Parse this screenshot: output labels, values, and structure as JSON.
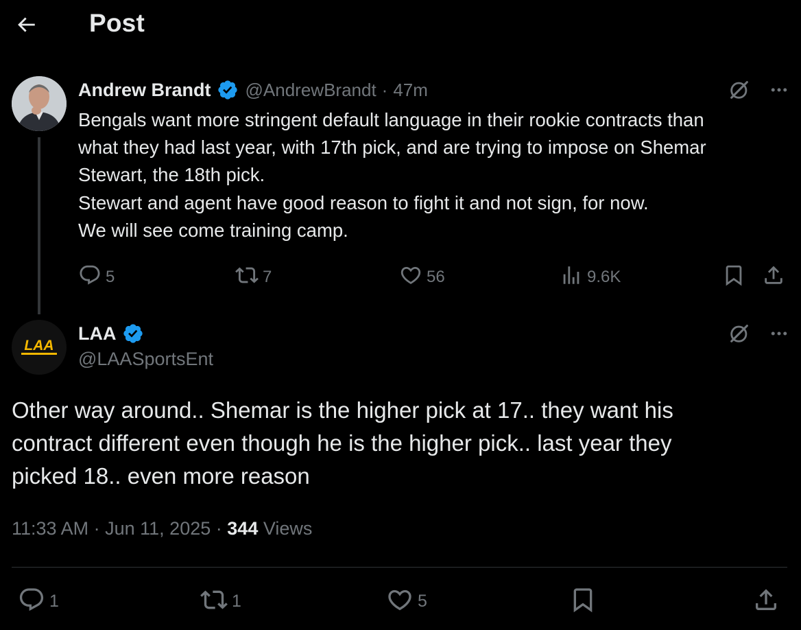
{
  "header": {
    "title": "Post"
  },
  "parent_tweet": {
    "display_name": "Andrew Brandt",
    "handle": "@AndrewBrandt",
    "separator": "·",
    "time_ago": "47m",
    "text_lines": [
      "Bengals want more stringent default language in their rookie contracts than",
      "what they had last year, with 17th pick, and are trying to impose on Shemar",
      "Stewart, the 18th pick.",
      "Stewart and agent have good reason to fight it and not sign, for now.",
      "We will see come training camp."
    ],
    "replies": "5",
    "reposts": "7",
    "likes": "56",
    "views": "9.6K"
  },
  "reply_tweet": {
    "display_name": "LAA",
    "handle": "@LAASportsEnt",
    "avatar_logo_text": "LAA",
    "text_lines": [
      "Other way around.. Shemar is the higher pick at 17.. they want his",
      "contract different even though he is the higher pick.. last year they",
      "picked 18.. even more reason"
    ],
    "time": "11:33 AM",
    "separator": "·",
    "date": "Jun 11, 2025",
    "separator2": "·",
    "views_count": "344",
    "views_label": "Views",
    "replies": "1",
    "reposts": "1",
    "likes": "5"
  },
  "colors": {
    "background": "#000000",
    "text_primary": "#e7e9ea",
    "text_secondary": "#71767b",
    "verified_blue": "#1d9bf0",
    "divider": "#2f3336",
    "laa_gold": "#f5b800"
  },
  "icons": {
    "back": "arrow-left-icon",
    "verified": "verified-badge-icon",
    "grok": "grok-icon",
    "more": "more-icon",
    "reply": "reply-icon",
    "repost": "repost-icon",
    "like": "heart-icon",
    "views": "views-icon",
    "bookmark": "bookmark-icon",
    "share": "share-icon"
  }
}
